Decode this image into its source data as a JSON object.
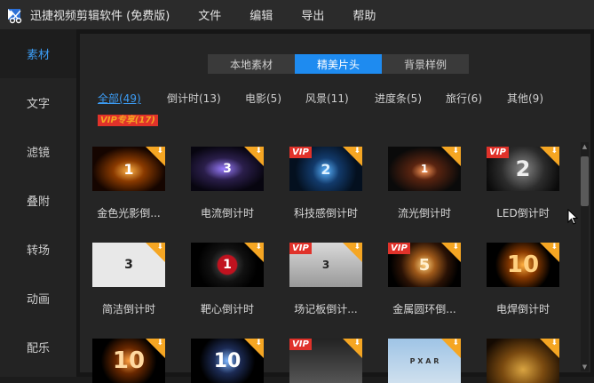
{
  "app": {
    "title": "迅捷视频剪辑软件 (免费版)"
  },
  "menu": [
    "文件",
    "编辑",
    "导出",
    "帮助"
  ],
  "sidebar": {
    "items": [
      {
        "label": "素材",
        "active": true
      },
      {
        "label": "文字",
        "active": false
      },
      {
        "label": "滤镜",
        "active": false
      },
      {
        "label": "叠附",
        "active": false
      },
      {
        "label": "转场",
        "active": false
      },
      {
        "label": "动画",
        "active": false
      },
      {
        "label": "配乐",
        "active": false
      }
    ]
  },
  "tabs": [
    {
      "label": "本地素材",
      "active": false
    },
    {
      "label": "精美片头",
      "active": true
    },
    {
      "label": "背景样例",
      "active": false
    }
  ],
  "categories": [
    {
      "label": "全部(49)",
      "active": true
    },
    {
      "label": "倒计时(13)"
    },
    {
      "label": "电影(5)"
    },
    {
      "label": "风景(11)"
    },
    {
      "label": "进度条(5)"
    },
    {
      "label": "旅行(6)"
    },
    {
      "label": "其他(9)"
    },
    {
      "label": "VIP专享(17)",
      "vip": true
    }
  ],
  "templates": [
    {
      "label": "金色光影倒...",
      "vip": false,
      "numeral": "1",
      "theme": "gold-streak"
    },
    {
      "label": "电流倒计时",
      "vip": false,
      "numeral": "3",
      "theme": "electric"
    },
    {
      "label": "科技感倒计时",
      "vip": true,
      "numeral": "2",
      "theme": "tech"
    },
    {
      "label": "流光倒计时",
      "vip": false,
      "numeral": "1",
      "theme": "streamer"
    },
    {
      "label": "LED倒计时",
      "vip": true,
      "numeral": "2",
      "theme": "led"
    },
    {
      "label": "简洁倒计时",
      "vip": false,
      "numeral": "3",
      "theme": "simple"
    },
    {
      "label": "靶心倒计时",
      "vip": false,
      "numeral": "1",
      "theme": "bullseye"
    },
    {
      "label": "场记板倒计...",
      "vip": true,
      "numeral": "3",
      "theme": "clapper"
    },
    {
      "label": "金属圆环倒...",
      "vip": true,
      "numeral": "5",
      "theme": "metal-ring"
    },
    {
      "label": "电焊倒计时",
      "vip": false,
      "numeral": "10",
      "theme": "weld"
    },
    {
      "label": "",
      "vip": false,
      "numeral": "10",
      "theme": "fire"
    },
    {
      "label": "",
      "vip": false,
      "numeral": "10",
      "theme": "sparkle"
    },
    {
      "label": "",
      "vip": true,
      "numeral": "",
      "theme": "clapper2"
    },
    {
      "label": "",
      "vip": false,
      "numeral": "",
      "theme": "pixar",
      "text": "P  X  A  R"
    },
    {
      "label": "",
      "vip": false,
      "numeral": "",
      "theme": "mgm"
    }
  ],
  "vip_badge": "VIP",
  "download_icon": "download-icon",
  "colors": {
    "accent": "#1e8bf0",
    "link": "#3c9cf4",
    "vip": "#f5a623",
    "vip_badge": "#e0322a"
  }
}
